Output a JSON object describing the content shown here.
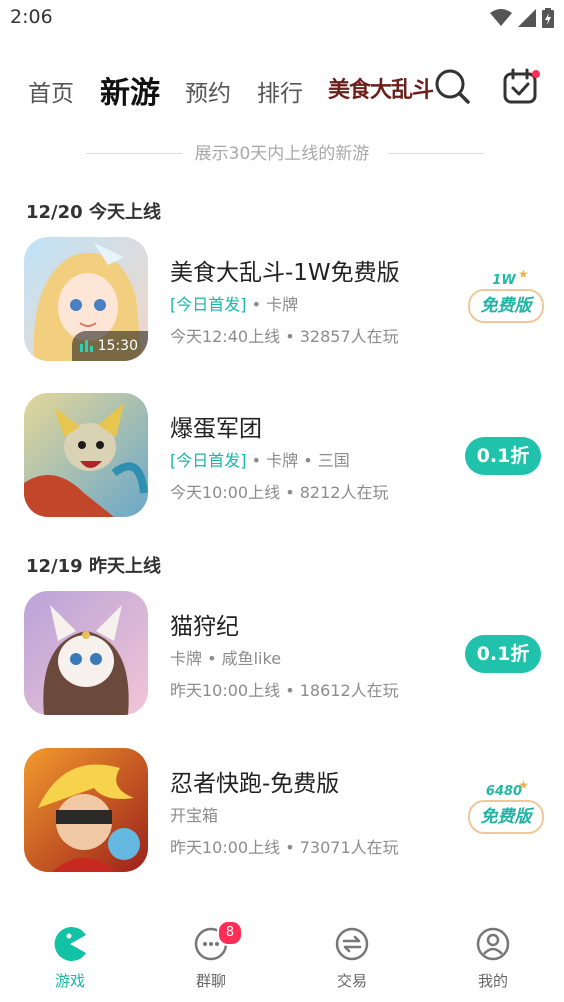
{
  "status_bar": {
    "time": "2:06"
  },
  "nav": {
    "tabs": [
      {
        "label": "首页"
      },
      {
        "label": "新游"
      },
      {
        "label": "预约"
      },
      {
        "label": "排行"
      }
    ],
    "logo_text": "美食大乱斗",
    "search_icon": "search-icon",
    "checkin_icon": "calendar-check-icon"
  },
  "subtitle": "展示30天内上线的新游",
  "sections": [
    {
      "title": "12/20 今天上线",
      "games": [
        {
          "name": "美食大乱斗-1W免费版",
          "tag_highlight": "[今日首发]",
          "tags": " • 卡牌",
          "meta": "今天12:40上线 • 32857人在玩",
          "time_chip": "15:30",
          "badge_top": "1W",
          "badge_bottom": "免费版"
        },
        {
          "name": "爆蛋军团",
          "tag_highlight": "[今日首发]",
          "tags": " • 卡牌 • 三国",
          "meta": "今天10:00上线 • 8212人在玩",
          "button": "0.1折"
        }
      ]
    },
    {
      "title": "12/19 昨天上线",
      "games": [
        {
          "name": "猫狩纪",
          "tag_highlight": "",
          "tags": "卡牌 • 咸鱼like",
          "meta": "昨天10:00上线 • 18612人在玩",
          "button": "0.1折"
        },
        {
          "name": "忍者快跑-免费版",
          "tag_highlight": "",
          "tags": "开宝箱",
          "meta": "昨天10:00上线 • 73071人在玩",
          "badge_top": "6480",
          "badge_bottom": "免费版"
        }
      ]
    }
  ],
  "bottom_nav": [
    {
      "label": "游戏",
      "icon": "pacman-icon"
    },
    {
      "label": "群聊",
      "icon": "chat-icon",
      "badge": "8"
    },
    {
      "label": "交易",
      "icon": "exchange-icon"
    },
    {
      "label": "我的",
      "icon": "user-icon"
    }
  ],
  "colors": {
    "accent": "#20c2ac",
    "badge": "#ff2d55"
  }
}
